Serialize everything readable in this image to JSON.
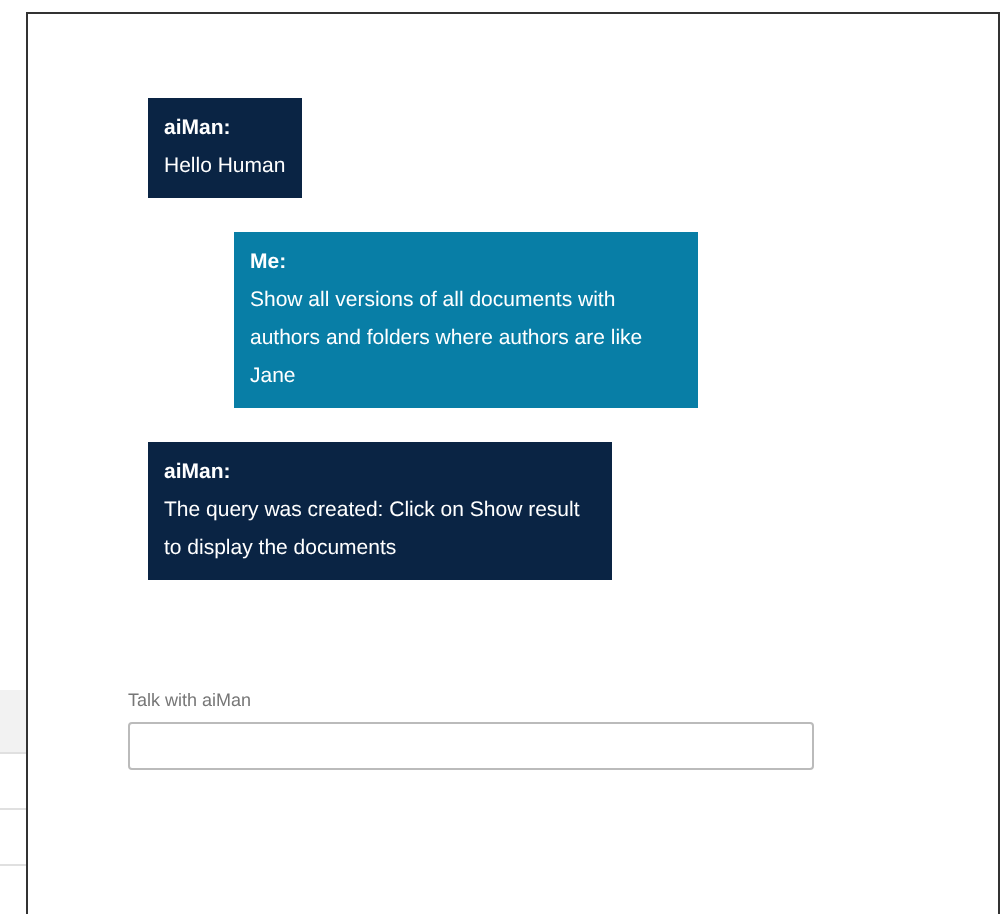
{
  "messages": [
    {
      "kind": "bot",
      "author": "aiMan:",
      "text": "Hello Human"
    },
    {
      "kind": "user",
      "author": "Me:",
      "text": "Show all versions of all documents with authors and folders where authors are like Jane"
    },
    {
      "kind": "bot",
      "author": "aiMan:",
      "text": "The query was created: Click on Show result to display the documents"
    }
  ],
  "input": {
    "label": "Talk with aiMan"
  }
}
